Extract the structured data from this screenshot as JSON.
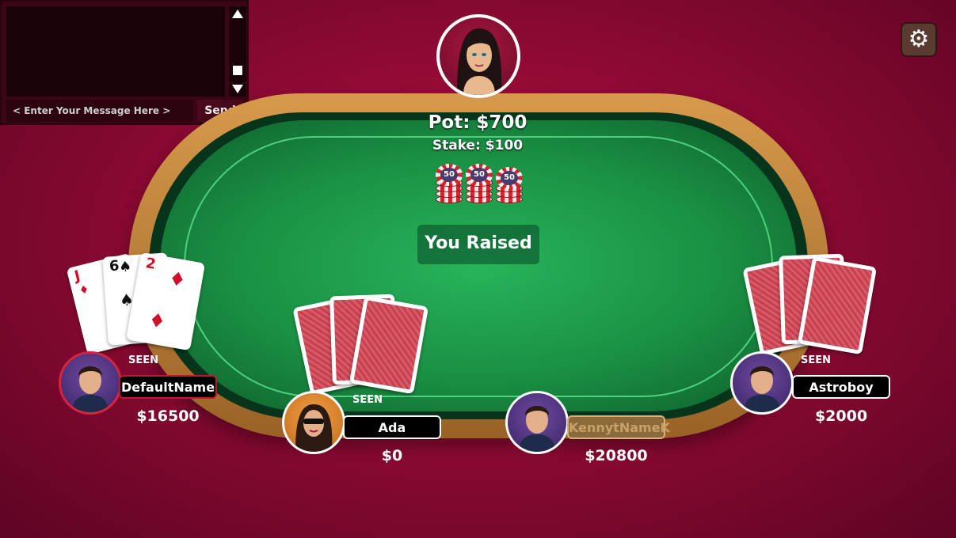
{
  "chat": {
    "input_placeholder": "< Enter Your Message Here >",
    "send_label": "Send"
  },
  "table": {
    "pot_label": "Pot: $700",
    "stake_label": "Stake: $100",
    "chip_value": "50",
    "status": "You Raised"
  },
  "players": [
    {
      "name": "DefaultName",
      "chips": "$16500",
      "status": "SEEN",
      "cards": [
        "J",
        "6",
        "2"
      ]
    },
    {
      "name": "Ada",
      "chips": "$0",
      "status": "SEEN"
    },
    {
      "name": "KennytNameK",
      "chips": "$20800"
    },
    {
      "name": "Astroboy",
      "chips": "$2000",
      "status": "SEEN"
    }
  ],
  "icons": {
    "settings": "gear-icon"
  }
}
